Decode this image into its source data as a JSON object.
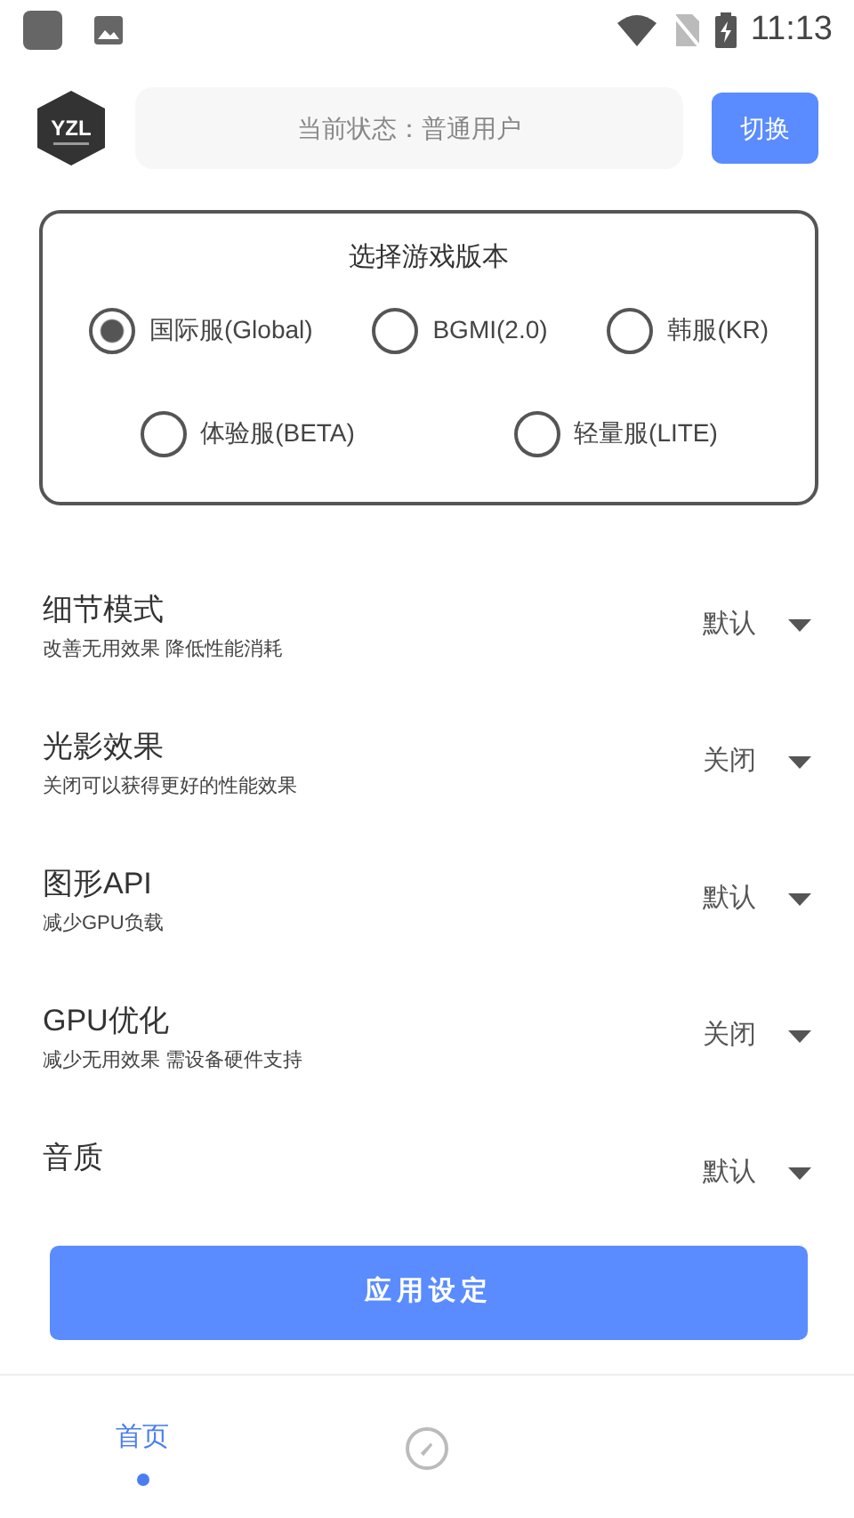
{
  "status_bar": {
    "time": "11:13"
  },
  "header": {
    "logo": "YZL",
    "status_text": "当前状态：普通用户",
    "switch_button": "切换"
  },
  "version_dialog": {
    "title": "选择游戏版本",
    "options": [
      {
        "label": "国际服(Global)",
        "selected": true
      },
      {
        "label": "BGMI(2.0)",
        "selected": false
      },
      {
        "label": "韩服(KR)",
        "selected": false
      },
      {
        "label": "体验服(BETA)",
        "selected": false
      },
      {
        "label": "轻量服(LITE)",
        "selected": false
      }
    ]
  },
  "settings": [
    {
      "title": "细节模式",
      "description": "改善无用效果 降低性能消耗",
      "value": "默认"
    },
    {
      "title": "光影效果",
      "description": "关闭可以获得更好的性能效果",
      "value": "关闭"
    },
    {
      "title": "图形API",
      "description": "减少GPU负载",
      "value": "默认"
    },
    {
      "title": "GPU优化",
      "description": "减少无用效果 需设备硬件支持",
      "value": "关闭"
    },
    {
      "title": "音质",
      "value": "默认"
    }
  ],
  "apply_button": "应用设定",
  "bottom_nav": [
    {
      "kind": "text",
      "label": "首页",
      "selected": true
    },
    {
      "kind": "icon",
      "selected": false
    }
  ]
}
